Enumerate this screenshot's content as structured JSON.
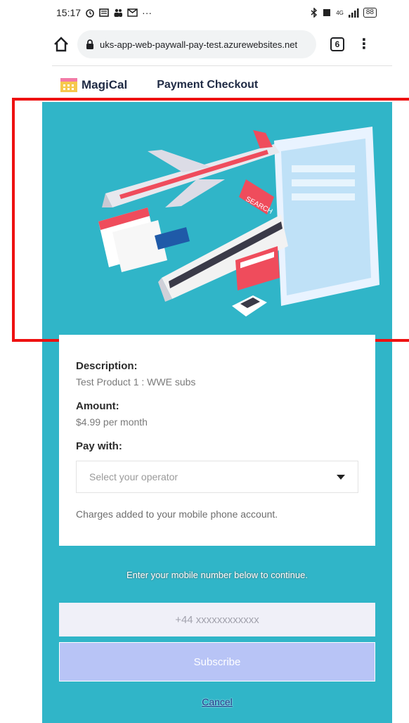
{
  "status_bar": {
    "time": "15:17",
    "notification_icons": [
      "alarm-icon",
      "news-icon",
      "people-icon",
      "gmail-icon"
    ],
    "more": "···",
    "network": "4G",
    "battery": "88"
  },
  "browser": {
    "url": "uks-app-web-paywall-pay-test.azurewebsites.net",
    "tab_count": "6"
  },
  "app": {
    "logo_text": "MagiCal",
    "page_title": "Payment Checkout"
  },
  "hero": {
    "search_tag": "SEARCH"
  },
  "card": {
    "description_label": "Description:",
    "description_value": "Test Product 1 : WWE subs",
    "amount_label": "Amount:",
    "amount_value": "$4.99 per month",
    "pay_with_label": "Pay with:",
    "operator_placeholder": "Select your operator",
    "charges_note": "Charges added to your mobile phone account."
  },
  "form": {
    "instruction": "Enter your mobile number below to continue.",
    "phone_placeholder": "+44 xxxxxxxxxxxx",
    "subscribe_label": "Subscribe",
    "cancel_label": "Cancel"
  },
  "colors": {
    "teal_background": "#30b5c8",
    "subscribe_button": "#b8c4f6",
    "highlight_border": "#ee1111"
  }
}
